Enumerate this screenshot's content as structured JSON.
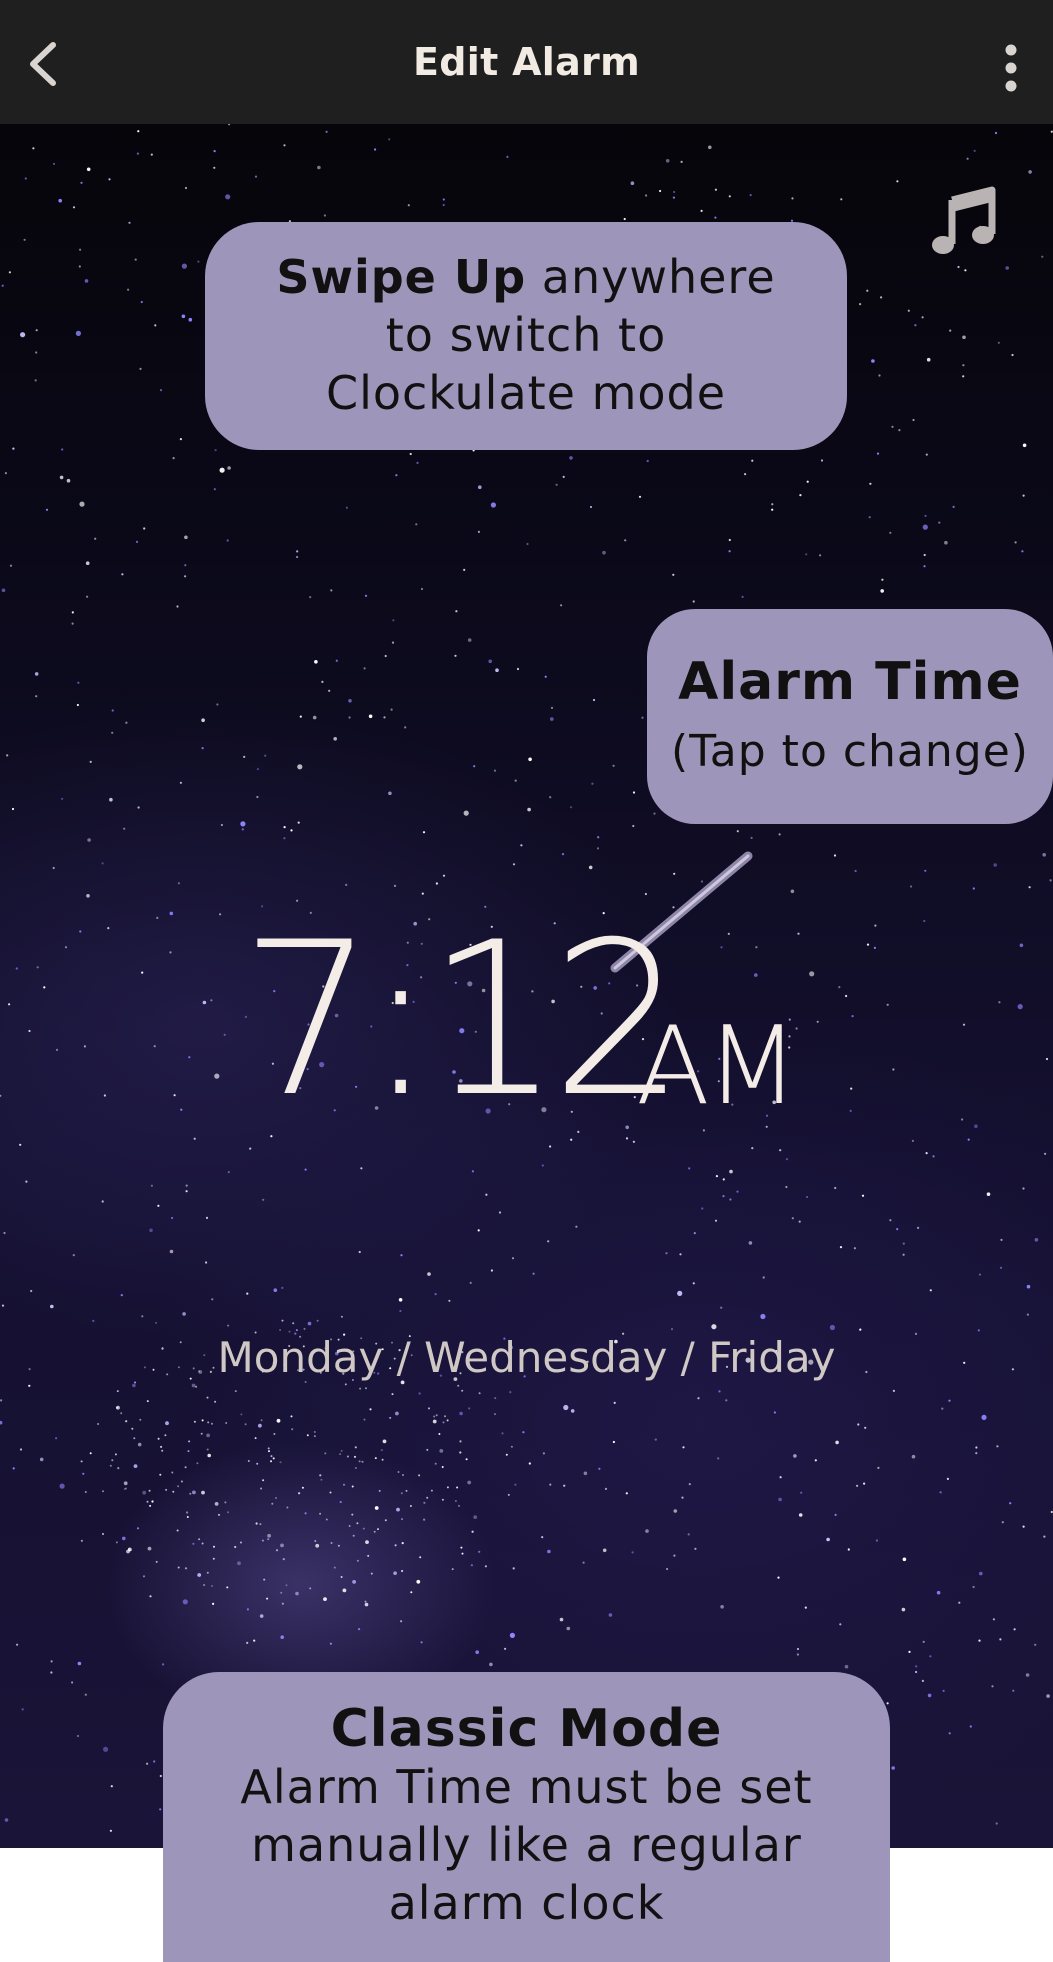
{
  "header": {
    "title": "Edit Alarm",
    "back_icon": "chevron-left-icon",
    "menu_icon": "more-vertical-icon"
  },
  "music_icon": "music-note-icon",
  "hints": {
    "swipe": {
      "bold": "Swipe Up",
      "rest_line1": " anywhere",
      "line2": "to switch to",
      "line3": "Clockulate mode"
    },
    "alarm_time": {
      "title": "Alarm Time",
      "subtitle": "(Tap to change)"
    },
    "classic": {
      "title": "Classic Mode",
      "line1": "Alarm Time must be set",
      "line2": "manually like a regular",
      "line3": "alarm clock"
    }
  },
  "alarm": {
    "time": "7:12",
    "period": "AM",
    "days": "Monday / Wednesday / Friday"
  },
  "colors": {
    "topbar": "#1f1f1f",
    "bubble": "#9e96ba",
    "time_text": "#f4ece6",
    "days_text": "#cfc8c4"
  }
}
